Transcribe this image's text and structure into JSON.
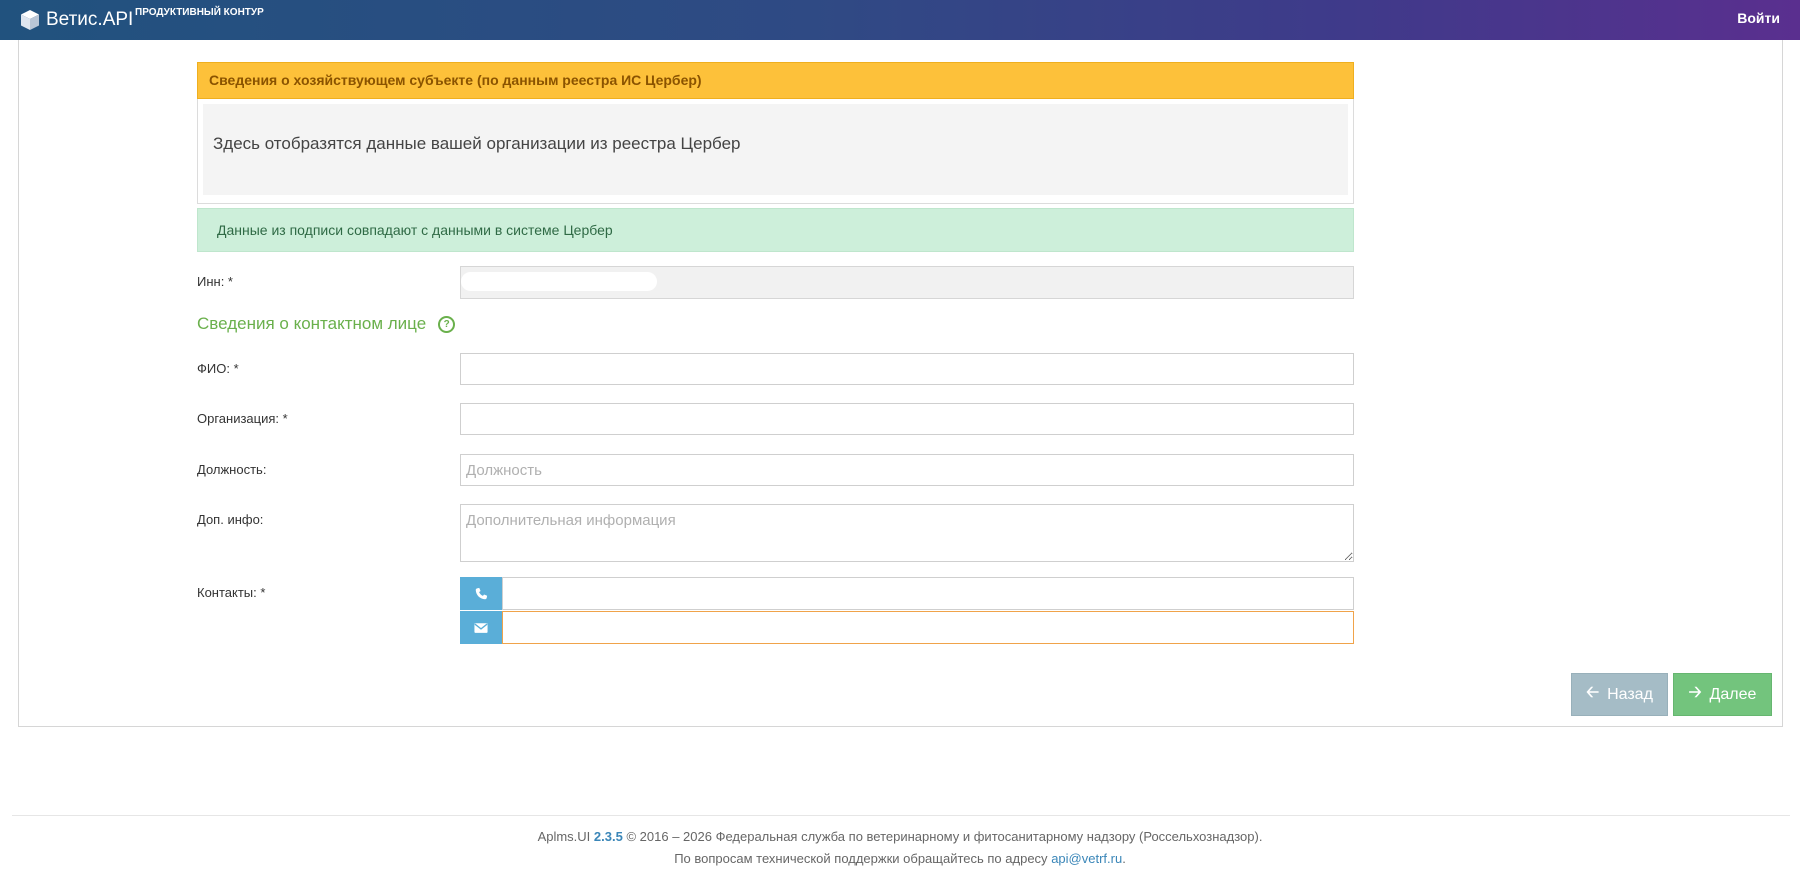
{
  "header": {
    "brand": "Ветис.API",
    "subtitle": "ПРОДУКТИВНЫЙ КОНТУР",
    "login_label": "Войти",
    "logo_icon": "cube-icon"
  },
  "org_panel": {
    "title": "Сведения о хозяйствующем субъекте (по данным реестра ИС Цербер)",
    "placeholder_text": "Здесь отобразятся данные вашей организации из реестра Цербер"
  },
  "alert": {
    "text": "Данные из подписи совпадают с данными в системе Цербер"
  },
  "form": {
    "inn_label": "Инн: *",
    "inn_value": "",
    "contact_section_title": "Сведения о контактном лице",
    "help_icon": "question-circle-icon",
    "fio_label": "ФИО: *",
    "fio_value": "",
    "org_label": "Организация: *",
    "org_value": "",
    "position_label": "Должность:",
    "position_placeholder": "Должность",
    "info_label": "Доп. инфо:",
    "info_placeholder": "Дополнительная информация",
    "contacts_label": "Контакты: *",
    "phone_icon": "phone-icon",
    "phone_value": "",
    "email_icon": "envelope-icon",
    "email_value": ""
  },
  "buttons": {
    "back_label": "Назад",
    "back_icon": "arrow-left-icon",
    "next_label": "Далее",
    "next_icon": "arrow-right-icon"
  },
  "footer": {
    "product": "Aplms.UI",
    "version": "2.3.5",
    "copyright": "© 2016 – 2026 Федеральная служба по ветеринарному и фитосанитарному надзору (Россельхознадзор).",
    "support_text": "По вопросам технической поддержки обращайтесь по адресу",
    "support_email": "api@vetrf.ru"
  },
  "colors": {
    "header_gradient_start": "#21527e",
    "header_gradient_end": "#5a2f8f",
    "panel_warning": "#fdc13a",
    "alert_success": "#cdefda",
    "section_title": "#6ab04c",
    "addon": "#5aaed8",
    "btn_back": "#a5bcc6",
    "btn_next": "#73c47d",
    "focus_border": "#f0a34a"
  }
}
